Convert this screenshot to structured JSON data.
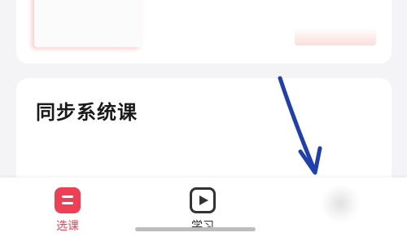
{
  "course_section": {
    "title": "同步系统课"
  },
  "tabbar": {
    "tabs": [
      {
        "label": "选课",
        "icon": "course-select-icon",
        "active": true
      },
      {
        "label": "学习",
        "icon": "play-video-icon",
        "active": false
      }
    ]
  },
  "colors": {
    "accent": "#ef3f55",
    "background": "#f4f4f6",
    "annotation_arrow": "#1f3fae"
  }
}
